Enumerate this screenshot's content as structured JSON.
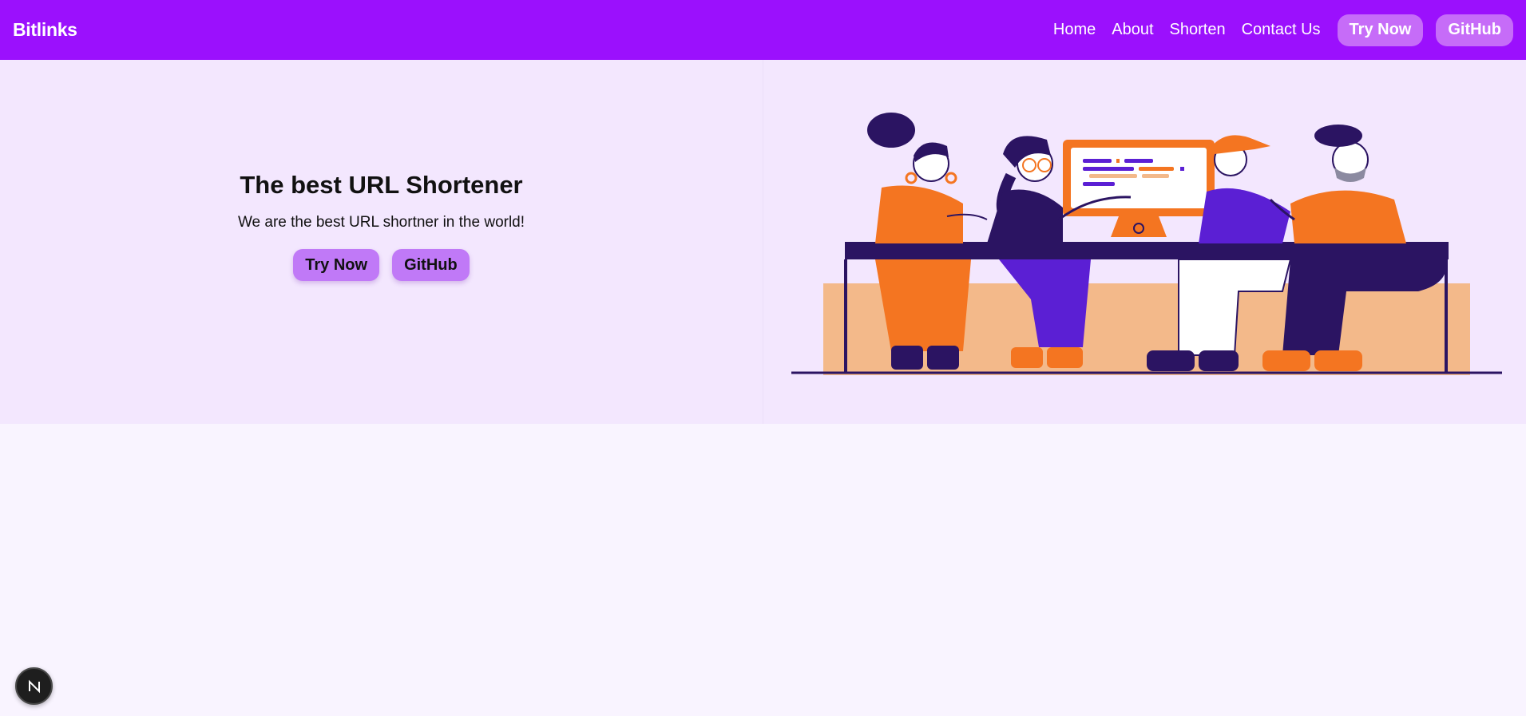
{
  "navbar": {
    "brand": "Bitlinks",
    "links": [
      "Home",
      "About",
      "Shorten",
      "Contact Us"
    ],
    "buttons": [
      "Try Now",
      "GitHub"
    ],
    "background": "#9b10fd"
  },
  "hero": {
    "title": "The best URL Shortener",
    "subtitle": "We are the best URL shortner in the world!",
    "buttons": [
      "Try Now",
      "GitHub"
    ],
    "background": "#f3e7fe"
  },
  "illustration": {
    "description_icon": "team-meeting-illustration",
    "colors": {
      "orange": "#f47521",
      "purple": "#5b1fd4",
      "dark": "#2b1462",
      "peach": "#f3b98a"
    }
  },
  "dev_badge": {
    "icon": "nextjs-icon",
    "label": "N"
  }
}
